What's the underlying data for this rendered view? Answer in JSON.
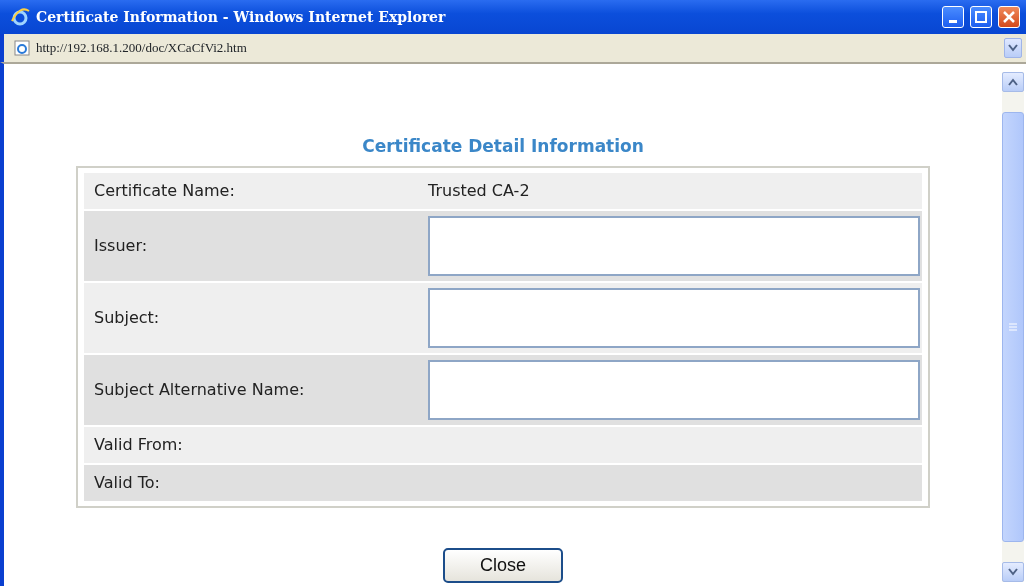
{
  "window": {
    "title": "Certificate Information - Windows Internet Explorer"
  },
  "address_bar": {
    "url": "http://192.168.1.200/doc/XCaCfVi2.htm"
  },
  "heading": "Certificate Detail Information",
  "rows": [
    {
      "label": "Certificate Name:",
      "kind": "text",
      "value": "Trusted CA-2"
    },
    {
      "label": "Issuer:",
      "kind": "textarea"
    },
    {
      "label": "Subject:",
      "kind": "textarea"
    },
    {
      "label": "Subject Alternative Name:",
      "kind": "textarea"
    },
    {
      "label": "Valid From:",
      "kind": "text"
    },
    {
      "label": "Valid To:",
      "kind": "text"
    }
  ],
  "close_button": "Close"
}
